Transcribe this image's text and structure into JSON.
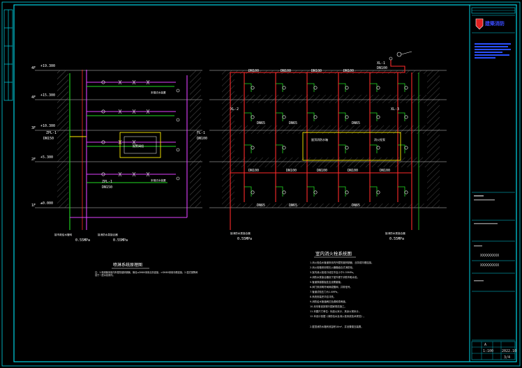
{
  "drawing": {
    "left_title": "喷淋系统原理图",
    "right_title": "室内消火栓系统图",
    "company_logo_text": "建築消防"
  },
  "floors": {
    "left": [
      {
        "tag": "4F",
        "elev": "+19.300"
      },
      {
        "tag": "4F",
        "elev": "+15.300"
      },
      {
        "tag": "3F",
        "elev": "+10.300"
      },
      {
        "tag": "2F",
        "elev": "+5.300"
      },
      {
        "tag": "1F",
        "elev": "±0.000"
      }
    ]
  },
  "left_labels": {
    "zpl1": "ZPL-1",
    "dn150": "DN150",
    "zpl2": "ZPL-1",
    "dn150b": "DN150",
    "fl1": "FL-1",
    "dn100": "DN100",
    "valve_room": "报警阀组",
    "room_note": "末端试水装置",
    "inlet_a": "接市政给水管网",
    "inlet_b": "接消防水泵接合器",
    "press_a": "0.55MPa",
    "press_b": "0.55MPa"
  },
  "right_labels": {
    "xl1": "XL-1",
    "xl2": "XL-2",
    "xl3": "XL-3",
    "dn100": "DN100",
    "dn65": "DN65",
    "tank": "屋顶消防水箱",
    "pump": "消火栓泵",
    "inlet": "接消防水泵接合器",
    "press": "0.55MPa"
  },
  "notes": {
    "left_note": "注：1.喷淋管采用内外壁热镀锌钢管，管径≤DN80采用丝扣连接，>DN80采用沟槽连接。2.湿式报警阀设于一层水泵房内。",
    "right_items": [
      "1.消火栓给水管道采用内外壁热镀锌钢管，丝扣或沟槽连接。",
      "2.消火栓箱采用带灭火器箱组合式消防柜。",
      "3.室内消火栓栓口动压不应小于0.35MPa。",
      "4.消防水泵接合器设于室外便于消防车取水处。",
      "5.管道穿越楼板处应设置套管。",
      "6.阀门采用明杆闸阀或蝶阀，并带信号。",
      "7.管道试验压力为1.4MPa。",
      "8.系统安装完毕应冲洗。",
      "9.消防给水管道刷红色调和漆两道。",
      "10.未尽事宜按现行国家规范施工。",
      "11.本图尺寸单位：标高以米计，其余以毫米计。",
      "12.本设计依据《消防给水及消火栓系统技术规范》。"
    ],
    "right_tail": "2.屋顶消防水箱有效容积18m³，并设置稳压装置。"
  },
  "title_block": {
    "row1": "XXXXXXXXX",
    "row2": "XXXXXXXXX",
    "scale": "1:100",
    "date": "2022.10",
    "sheet": "A",
    "num": "3/4"
  },
  "colors": {
    "frame": "#00d4e6",
    "pipe_red": "#ff2a2a",
    "pipe_green": "#22dd22",
    "pipe_magenta": "#e040ff",
    "yellow": "#ffee00",
    "white": "#e8e8e8",
    "hatch": "#9a9a9a",
    "blue": "#2255ff"
  }
}
